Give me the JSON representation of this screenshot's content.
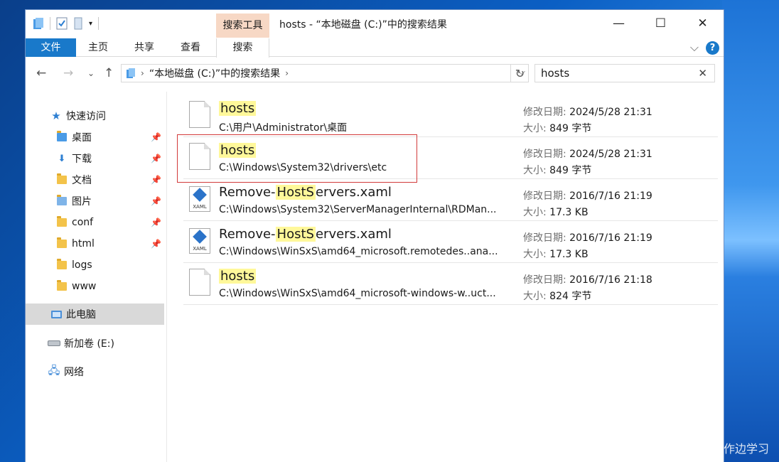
{
  "window": {
    "title": "hosts - “本地磁盘 (C:)”中的搜索结果",
    "context_tab": "搜索工具",
    "controls": {
      "minimize": "—",
      "maximize": "☐",
      "close": "✕"
    }
  },
  "ribbon": {
    "tabs": [
      {
        "label": "文件"
      },
      {
        "label": "主页"
      },
      {
        "label": "共享"
      },
      {
        "label": "查看"
      },
      {
        "label": "搜索"
      }
    ],
    "expand_icon": "⌵",
    "help": "?"
  },
  "address": {
    "path": "“本地磁盘 (C:)”中的搜索结果",
    "search_value": "hosts"
  },
  "navpane": {
    "quick_access": "快速访问",
    "items": [
      {
        "label": "桌面",
        "pinned": true
      },
      {
        "label": "下载",
        "pinned": true
      },
      {
        "label": "文档",
        "pinned": true
      },
      {
        "label": "图片",
        "pinned": true
      },
      {
        "label": "conf",
        "pinned": true
      },
      {
        "label": "html",
        "pinned": true
      },
      {
        "label": "logs",
        "pinned": false
      },
      {
        "label": "www",
        "pinned": false
      }
    ],
    "this_pc": "此电脑",
    "drive": "新加卷 (E:)",
    "network": "网络"
  },
  "results": [
    {
      "icon": "file-icon",
      "name_pre": "",
      "name_hl": "hosts",
      "name_post": "",
      "path": "C:\\用户\\Administrator\\桌面",
      "date_label": "修改日期:",
      "date": "2024/5/28 21:31",
      "size_label": "大小:",
      "size": "849 字节"
    },
    {
      "icon": "file-icon",
      "name_pre": "",
      "name_hl": "hosts",
      "name_post": "",
      "path": "C:\\Windows\\System32\\drivers\\etc",
      "date_label": "修改日期:",
      "date": "2024/5/28 21:31",
      "size_label": "大小:",
      "size": "849 字节"
    },
    {
      "icon": "xaml-icon",
      "name_pre": "Remove-",
      "name_hl": "HostS",
      "name_post": "ervers.xaml",
      "path": "C:\\Windows\\System32\\ServerManagerInternal\\RDMan...",
      "date_label": "修改日期:",
      "date": "2016/7/16 21:19",
      "size_label": "大小:",
      "size": "17.3 KB"
    },
    {
      "icon": "xaml-icon",
      "name_pre": "Remove-",
      "name_hl": "HostS",
      "name_post": "ervers.xaml",
      "path": "C:\\Windows\\WinSxS\\amd64_microsoft.remotedes..ana...",
      "date_label": "修改日期:",
      "date": "2016/7/16 21:19",
      "size_label": "大小:",
      "size": "17.3 KB"
    },
    {
      "icon": "file-icon",
      "name_pre": "",
      "name_hl": "hosts",
      "name_post": "",
      "path": "C:\\Windows\\WinSxS\\amd64_microsoft-windows-w..uct...",
      "date_label": "修改日期:",
      "date": "2016/7/16 21:18",
      "size_label": "大小:",
      "size": "824 字节"
    }
  ],
  "xaml_label": "XAML",
  "watermark": "CSDN @边工作边学习"
}
